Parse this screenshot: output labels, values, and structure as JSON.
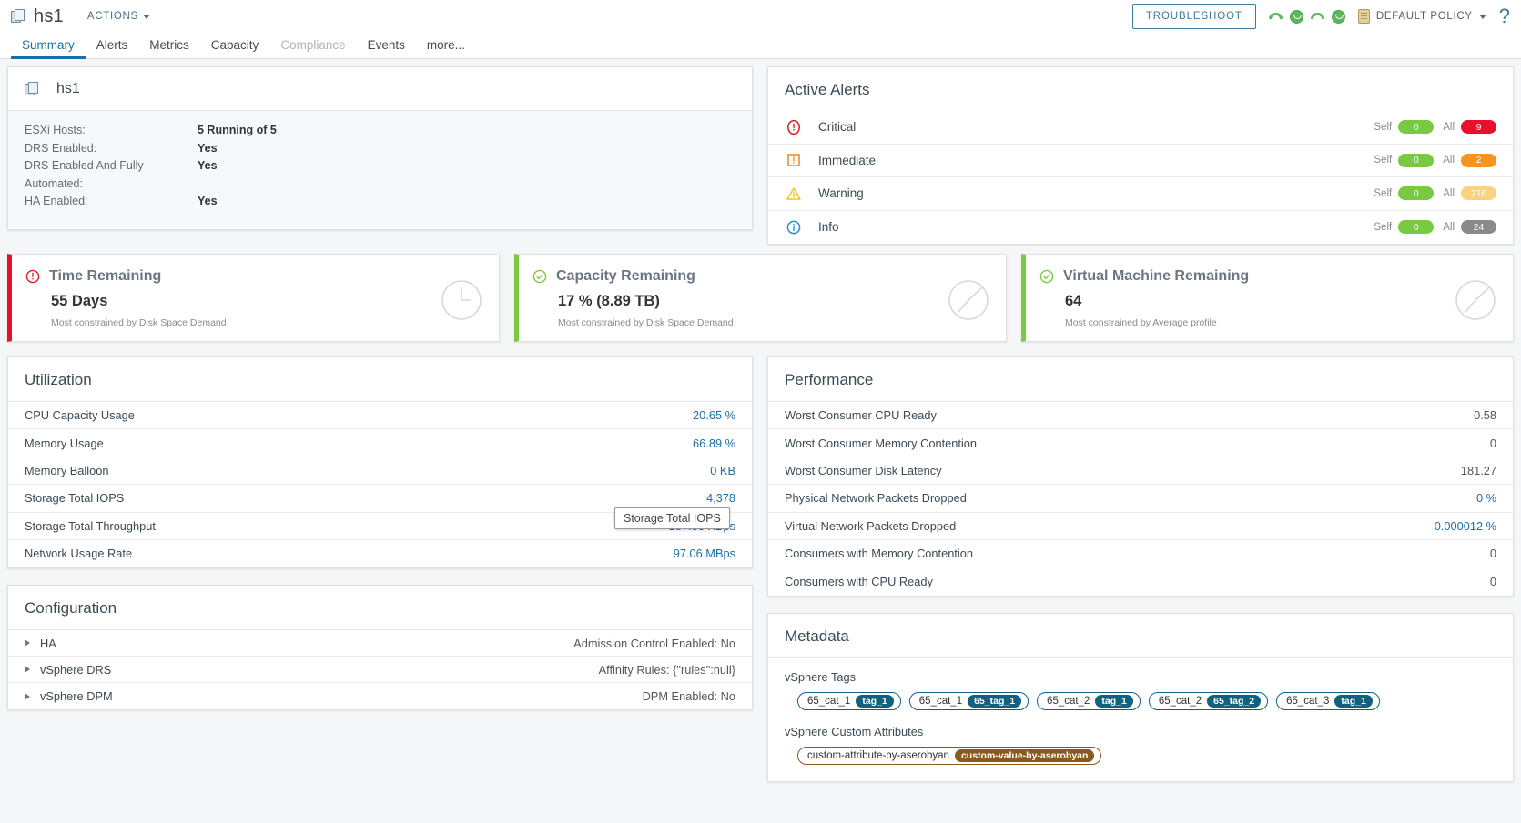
{
  "header": {
    "object_name": "hs1",
    "object_icon": "cluster-icon",
    "actions_label": "ACTIONS",
    "troubleshoot_label": "TROUBLESHOOT",
    "policy_label": "DEFAULT POLICY",
    "help_glyph": "?",
    "health_icons": [
      "gauge-green-icon",
      "smiley-green-icon",
      "gauge-green-icon",
      "smiley-green-icon"
    ]
  },
  "tabs": [
    {
      "label": "Summary",
      "state": "active"
    },
    {
      "label": "Alerts",
      "state": "normal"
    },
    {
      "label": "Metrics",
      "state": "normal"
    },
    {
      "label": "Capacity",
      "state": "normal"
    },
    {
      "label": "Compliance",
      "state": "disabled"
    },
    {
      "label": "Events",
      "state": "normal"
    },
    {
      "label": "more...",
      "state": "normal"
    }
  ],
  "object_summary": {
    "name": "hs1",
    "properties": [
      {
        "key": "ESXi Hosts:",
        "value": "5 Running of 5"
      },
      {
        "key": "DRS Enabled:",
        "value": "Yes"
      },
      {
        "key": "DRS Enabled And Fully Automated:",
        "value": "Yes"
      },
      {
        "key": "HA Enabled:",
        "value": "Yes"
      }
    ]
  },
  "active_alerts": {
    "title": "Active Alerts",
    "self_label": "Self",
    "all_label": "All",
    "rows": [
      {
        "icon": "critical-icon",
        "label": "Critical",
        "self": "0",
        "all": "9",
        "self_color": "#7ac943",
        "all_color": "#e8112d"
      },
      {
        "icon": "immediate-icon",
        "label": "Immediate",
        "self": "0",
        "all": "2",
        "self_color": "#7ac943",
        "all_color": "#f7941e"
      },
      {
        "icon": "warning-icon",
        "label": "Warning",
        "self": "0",
        "all": "216",
        "self_color": "#7ac943",
        "all_color": "#fbd27f"
      },
      {
        "icon": "info-icon",
        "label": "Info",
        "self": "0",
        "all": "24",
        "self_color": "#7ac943",
        "all_color": "#8a8a8a"
      }
    ]
  },
  "status_cards": [
    {
      "icon": "critical-icon",
      "accent": "#e8112d",
      "title": "Time Remaining",
      "value": "55 Days",
      "subtitle": "Most constrained by Disk Space Demand",
      "graphic": "clock-icon"
    },
    {
      "icon": "check-circle-icon",
      "accent": "#7ac943",
      "title": "Capacity Remaining",
      "value": "17 % (8.89 TB)",
      "subtitle": "Most constrained by Disk Space Demand",
      "graphic": "pie-icon"
    },
    {
      "icon": "check-circle-icon",
      "accent": "#7ac943",
      "title": "Virtual Machine Remaining",
      "value": "64",
      "subtitle": "Most constrained by Average profile",
      "graphic": "pie-icon"
    }
  ],
  "utilization": {
    "title": "Utilization",
    "rows": [
      {
        "name": "CPU Capacity Usage",
        "value": "20.65 %"
      },
      {
        "name": "Memory Usage",
        "value": "66.89 %"
      },
      {
        "name": "Memory Balloon",
        "value": "0 KB"
      },
      {
        "name": "Storage Total IOPS",
        "value": "4,378"
      },
      {
        "name": "Storage Total Throughput",
        "value": "187.33 KBps"
      },
      {
        "name": "Network Usage Rate",
        "value": "97.06 MBps"
      }
    ],
    "tooltip": "Storage Total IOPS"
  },
  "performance": {
    "title": "Performance",
    "rows": [
      {
        "name": "Worst Consumer CPU Ready",
        "value": "0.58"
      },
      {
        "name": "Worst Consumer Memory Contention",
        "value": "0"
      },
      {
        "name": "Worst Consumer Disk Latency",
        "value": "181.27"
      },
      {
        "name": "Physical Network Packets Dropped",
        "value": "0 %"
      },
      {
        "name": "Virtual Network Packets Dropped",
        "value": "0.000012 %"
      },
      {
        "name": "Consumers with Memory Contention",
        "value": "0"
      },
      {
        "name": "Consumers with CPU Ready",
        "value": "0"
      }
    ]
  },
  "configuration": {
    "title": "Configuration",
    "rows": [
      {
        "name": "HA",
        "value": "Admission Control Enabled: No"
      },
      {
        "name": "vSphere DRS",
        "value": "Affinity Rules: {\"rules\":null}"
      },
      {
        "name": "vSphere DPM",
        "value": "DPM Enabled: No"
      }
    ]
  },
  "metadata": {
    "title": "Metadata",
    "tags_label": "vSphere Tags",
    "tags": [
      {
        "category": "65_cat_1",
        "value": "tag_1"
      },
      {
        "category": "65_cat_1",
        "value": "65_tag_1"
      },
      {
        "category": "65_cat_2",
        "value": "tag_1"
      },
      {
        "category": "65_cat_2",
        "value": "65_tag_2"
      },
      {
        "category": "65_cat_3",
        "value": "tag_1"
      }
    ],
    "attributes_label": "vSphere Custom Attributes",
    "attributes": [
      {
        "key": "custom-attribute-by-aserobyan",
        "value": "custom-value-by-aserobyan"
      }
    ]
  }
}
